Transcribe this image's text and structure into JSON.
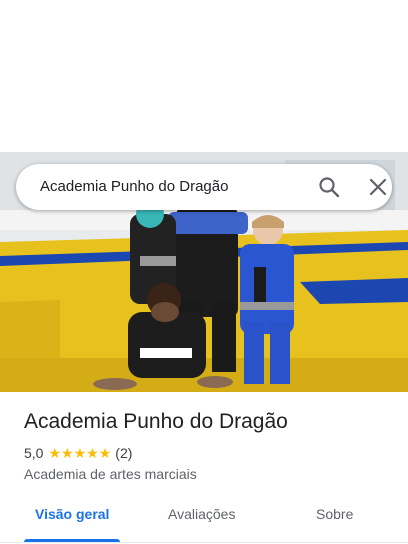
{
  "search": {
    "query": "Academia Punho do Dragão",
    "search_icon": "search-icon",
    "close_icon": "close-icon"
  },
  "photo": {
    "subject": "place-photo"
  },
  "place": {
    "title": "Academia Punho do Dragão",
    "rating": "5,0",
    "stars": 5,
    "review_count": "(2)",
    "category": "Academia de artes marciais"
  },
  "tabs": [
    {
      "label": "Visão geral",
      "active": true
    },
    {
      "label": "Avaliações",
      "active": false
    },
    {
      "label": "Sobre",
      "active": false
    }
  ],
  "colors": {
    "accent": "#1a73e8",
    "star": "#fbbc04",
    "mat_yellow": "#e7c21f",
    "mat_blue": "#1c46b0"
  }
}
